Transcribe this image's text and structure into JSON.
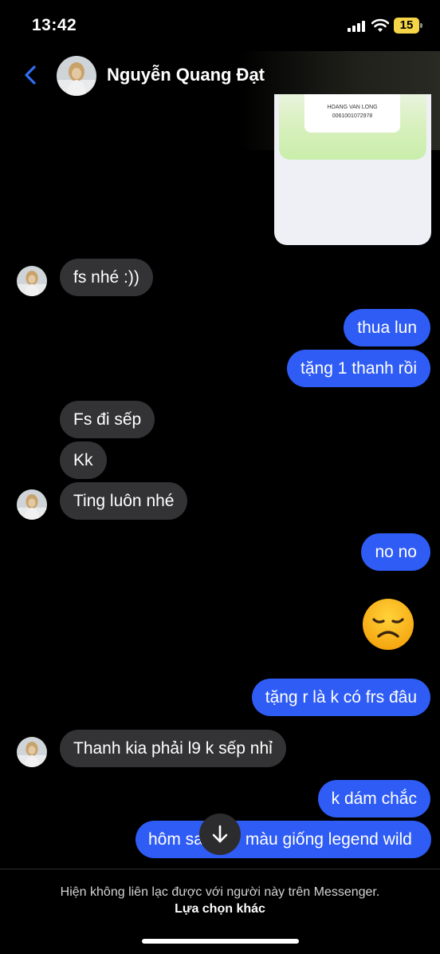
{
  "status_bar": {
    "time": "13:42",
    "battery_level": "15",
    "icons": [
      "signal-icon",
      "wifi-icon",
      "battery-icon"
    ]
  },
  "header": {
    "contact_name": "Nguyễn Quang Đạt",
    "back_icon": "chevron-left-icon"
  },
  "shared_image": {
    "account_name": "HOANG VAN LONG",
    "account_number": "0061001072978"
  },
  "messages": [
    {
      "from": "them",
      "text": "fs nhé :))"
    },
    {
      "from": "me",
      "text": "thua lun"
    },
    {
      "from": "me",
      "text": "tặng 1 thanh rồi"
    },
    {
      "from": "them",
      "text": "Fs đi sếp"
    },
    {
      "from": "them",
      "text": "Kk"
    },
    {
      "from": "them",
      "text": "Ting luôn nhé"
    },
    {
      "from": "me",
      "text": "no no"
    },
    {
      "from": "me",
      "emoji": "disappointed-face-emoji"
    },
    {
      "from": "me",
      "text": "tặng r là k có frs đâu"
    },
    {
      "from": "them",
      "text": "Thanh kia phải l9 k sếp nhỉ"
    },
    {
      "from": "me",
      "text": "k dám chắc"
    },
    {
      "from": "me",
      "text": "hôm sa",
      "text_after": "màu giống legend wild"
    }
  ],
  "footer": {
    "notice": "Hiện không liên lạc được với người này trên Messenger.",
    "other_options": "Lựa chọn khác"
  },
  "colors": {
    "background": "#000000",
    "incoming_bubble": "#333335",
    "outgoing_bubble": "#2f5cf5",
    "accent": "#2f6ff5",
    "battery": "#f5d547"
  }
}
